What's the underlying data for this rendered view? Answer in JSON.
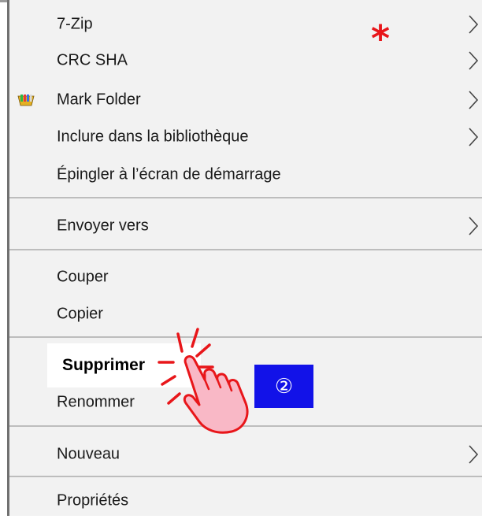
{
  "menu": {
    "items": [
      {
        "label": "7-Zip",
        "has_submenu": true
      },
      {
        "label": "CRC SHA",
        "has_submenu": true
      },
      {
        "label": "Mark Folder",
        "has_submenu": true,
        "icon": "mark-folder-icon"
      },
      {
        "label": "Inclure dans la bibliothèque",
        "has_submenu": true
      },
      {
        "label": "Épingler à l’écran de démarrage",
        "has_submenu": false
      },
      {
        "label": "Envoyer vers",
        "has_submenu": true
      },
      {
        "label": "Couper",
        "has_submenu": false
      },
      {
        "label": "Copier",
        "has_submenu": false
      },
      {
        "label": "Supprimer",
        "has_submenu": false,
        "highlighted": true
      },
      {
        "label": "Renommer",
        "has_submenu": false
      },
      {
        "label": "Nouveau",
        "has_submenu": true
      },
      {
        "label": "Propriétés",
        "has_submenu": false
      }
    ]
  },
  "annotations": {
    "star": "*",
    "step_badge": "②",
    "star_color": "#e8161a",
    "badge_color": "#1212e8",
    "pointer_icon": "hand-pointer-icon"
  }
}
